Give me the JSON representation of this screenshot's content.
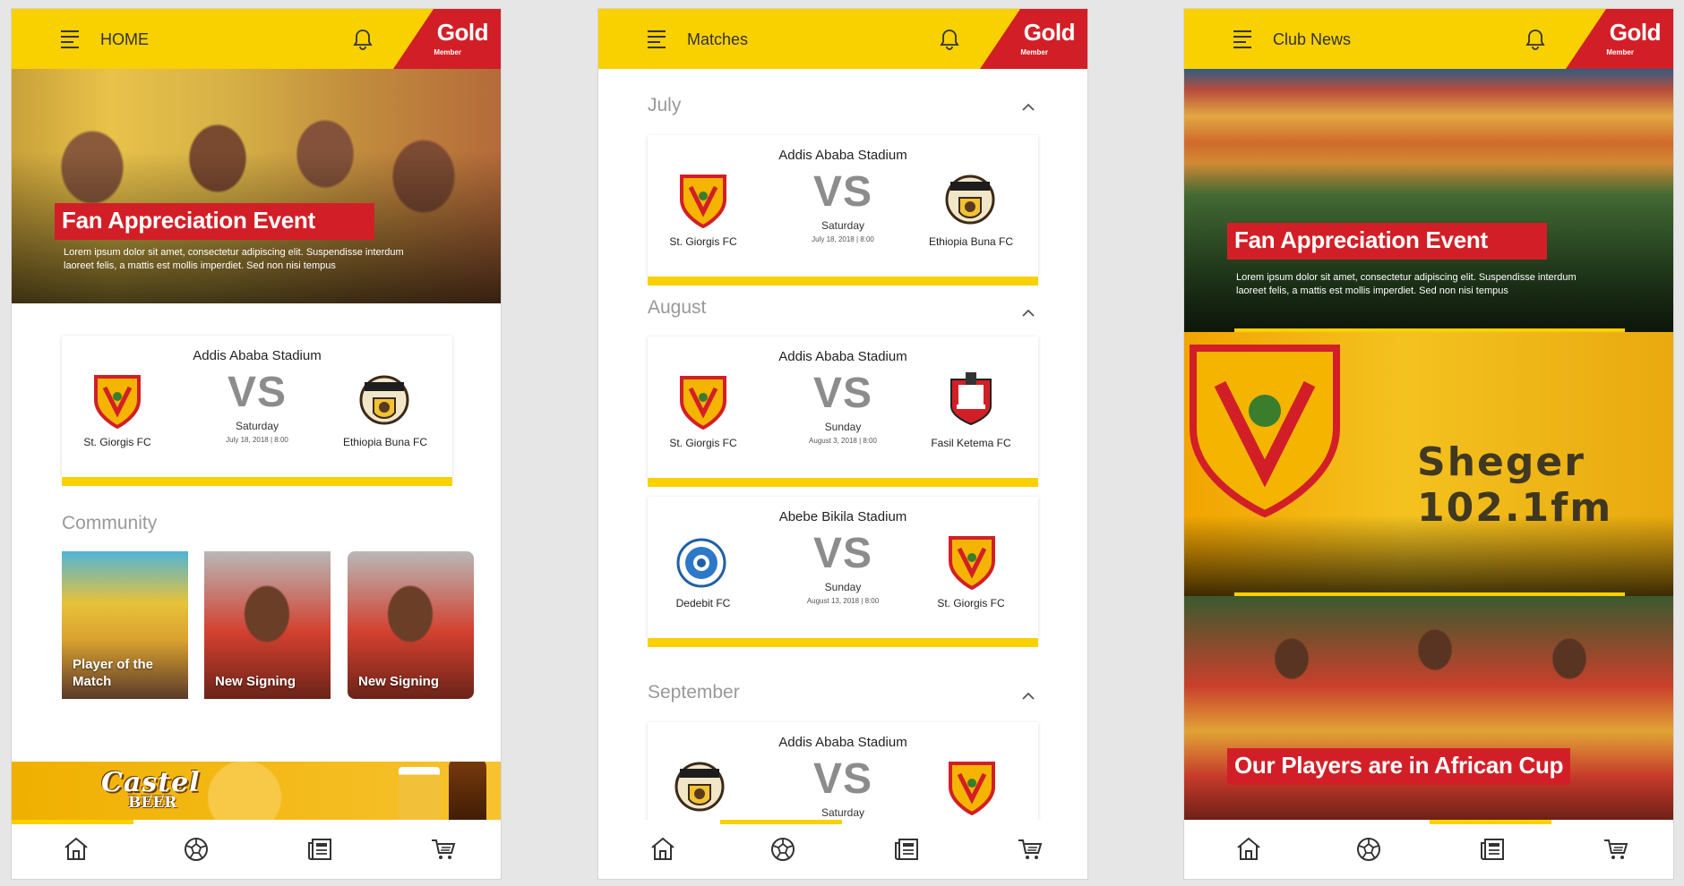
{
  "colors": {
    "accent": "#f9d000",
    "brand_red": "#d21f27",
    "muted": "#999999"
  },
  "member": {
    "tier": "Gold",
    "sub": "Member"
  },
  "screen1": {
    "title": "HOME",
    "hero": {
      "title": "Fan Appreciation Event",
      "desc_line1": "Lorem ipsum dolor sit amet, consectetur adipiscing elit. Suspendisse interdum",
      "desc_line2": "laoreet felis, a mattis est mollis imperdiet. Sed non nisi tempus"
    },
    "match": {
      "stadium": "Addis Ababa Stadium",
      "home": "St. Giorgis FC",
      "away": "Ethiopia Buna FC",
      "vs": "VS",
      "day": "Saturday",
      "datetime": "July 18, 2018 | 8:00"
    },
    "community": {
      "title": "Community",
      "tiles": [
        {
          "label": "Player of the Match"
        },
        {
          "label": "New Signing"
        },
        {
          "label": "New Signing"
        }
      ]
    },
    "ad": {
      "brand": "Castel",
      "product": "BEER"
    }
  },
  "screen2": {
    "title": "Matches",
    "months": [
      {
        "name": "July",
        "matches": [
          {
            "stadium": "Addis Ababa Stadium",
            "home": "St. Giorgis FC",
            "away": "Ethiopia Buna FC",
            "vs": "VS",
            "day": "Saturday",
            "datetime": "July 18, 2018 | 8:00"
          }
        ]
      },
      {
        "name": "August",
        "matches": [
          {
            "stadium": "Addis Ababa Stadium",
            "home": "St. Giorgis FC",
            "away": "Fasil Ketema FC",
            "vs": "VS",
            "day": "Sunday",
            "datetime": "August 3, 2018 | 8:00"
          },
          {
            "stadium": "Abebe Bikila Stadium",
            "home": "Dedebit FC",
            "away": "St. Giorgis FC",
            "vs": "VS",
            "day": "Sunday",
            "datetime": "August 13, 2018 | 8:00"
          }
        ]
      },
      {
        "name": "September",
        "matches": [
          {
            "stadium": "Addis Ababa Stadium",
            "vs": "VS",
            "day": "Saturday"
          }
        ]
      }
    ]
  },
  "screen3": {
    "title": "Club News",
    "news": [
      {
        "title": "Fan Appreciation Event",
        "desc_line1": "Lorem ipsum dolor sit amet, consectetur adipiscing elit. Suspendisse interdum",
        "desc_line2": "laoreet felis, a mattis est mollis imperdiet. Sed non nisi tempus"
      },
      {
        "image_text": "Sheger 102.1fm"
      },
      {
        "title": "Our Players are in African Cup"
      }
    ]
  },
  "nav": {
    "items": [
      "home-icon",
      "soccer-ball-icon",
      "news-icon",
      "cart-icon"
    ]
  }
}
